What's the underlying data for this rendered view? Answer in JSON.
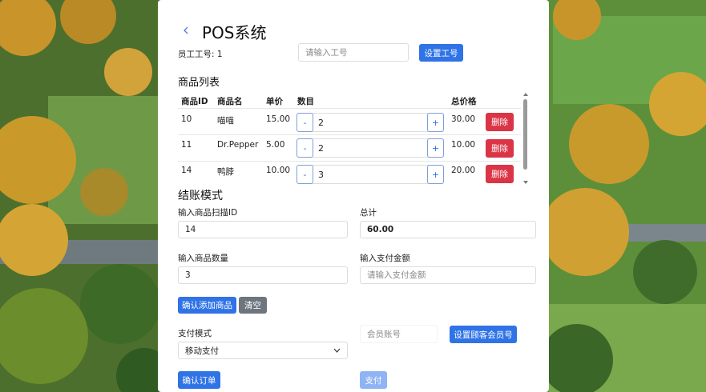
{
  "app": {
    "title": "POS系统"
  },
  "employee": {
    "label": "员工工号: 1",
    "id_placeholder": "请输入工号",
    "set_button": "设置工号"
  },
  "product_list": {
    "heading": "商品列表",
    "columns": [
      "商品ID",
      "商品名",
      "单价",
      "数目",
      "总价格"
    ],
    "rows": [
      {
        "id": "10",
        "name": "喵喵",
        "price": "15.00",
        "qty": "2",
        "total": "30.00"
      },
      {
        "id": "11",
        "name": "Dr.Pepper",
        "price": "5.00",
        "qty": "2",
        "total": "10.00"
      },
      {
        "id": "14",
        "name": "鸭脖",
        "price": "10.00",
        "qty": "3",
        "total": "20.00"
      }
    ],
    "minus_label": "-",
    "plus_label": "+",
    "delete_label": "删除"
  },
  "checkout": {
    "heading": "结账模式",
    "scan_id_label": "输入商品扫描ID",
    "scan_id_value": "14",
    "total_label": "总计",
    "total_value": "60.00",
    "qty_label": "输入商品数量",
    "qty_value": "3",
    "payment_amount_label": "输入支付金额",
    "payment_amount_placeholder": "请输入支付金额",
    "confirm_add_button": "确认添加商品",
    "clear_button": "清空",
    "payment_mode_label": "支付模式",
    "payment_mode_value": "移动支付",
    "member_placeholder": "会员账号",
    "set_member_button": "设置顾客会员号",
    "confirm_order_button": "确认订单",
    "pay_button": "支付"
  },
  "colors": {
    "primary": "#2f73e6",
    "primary_disabled": "#8fb3f3",
    "danger": "#db3446",
    "secondary": "#6d757d"
  },
  "icons": {
    "back": "chevron-left-icon",
    "dropdown": "chevron-down-icon"
  }
}
